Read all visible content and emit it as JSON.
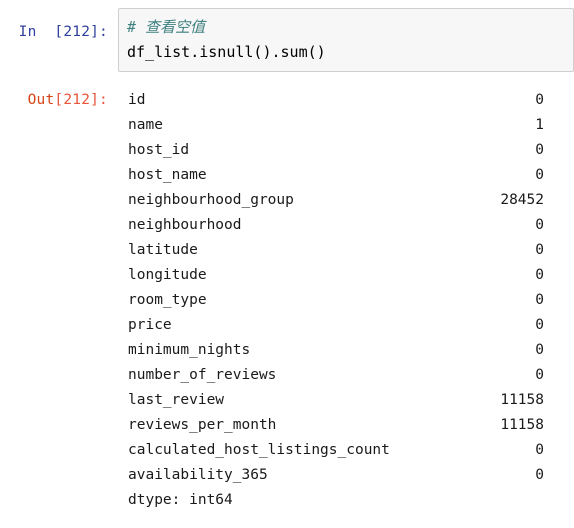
{
  "cell": {
    "input_prompt_label": "In",
    "input_prompt_number": "[212]:",
    "output_prompt_label": "Out",
    "output_prompt_number": "[212]:",
    "code": {
      "comment_line": "# 查看空值",
      "code_line": "df_list.isnull().sum()"
    },
    "colors": {
      "input_prompt": "#303f9f",
      "output_prompt": "#d84315",
      "comment": "#408080",
      "code": "#000000",
      "cell_background": "#f7f7f7",
      "cell_border": "#cfcfcf",
      "output_text": "#1a1a1a"
    }
  },
  "output": {
    "rows": [
      {
        "label": "id",
        "value": "0"
      },
      {
        "label": "name",
        "value": "1"
      },
      {
        "label": "host_id",
        "value": "0"
      },
      {
        "label": "host_name",
        "value": "0"
      },
      {
        "label": "neighbourhood_group",
        "value": "28452"
      },
      {
        "label": "neighbourhood",
        "value": "0"
      },
      {
        "label": "latitude",
        "value": "0"
      },
      {
        "label": "longitude",
        "value": "0"
      },
      {
        "label": "room_type",
        "value": "0"
      },
      {
        "label": "price",
        "value": "0"
      },
      {
        "label": "minimum_nights",
        "value": "0"
      },
      {
        "label": "number_of_reviews",
        "value": "0"
      },
      {
        "label": "last_review",
        "value": "11158"
      },
      {
        "label": "reviews_per_month",
        "value": "11158"
      },
      {
        "label": "calculated_host_listings_count",
        "value": "0"
      },
      {
        "label": "availability_365",
        "value": "0"
      }
    ],
    "dtype_line": "dtype: int64"
  }
}
